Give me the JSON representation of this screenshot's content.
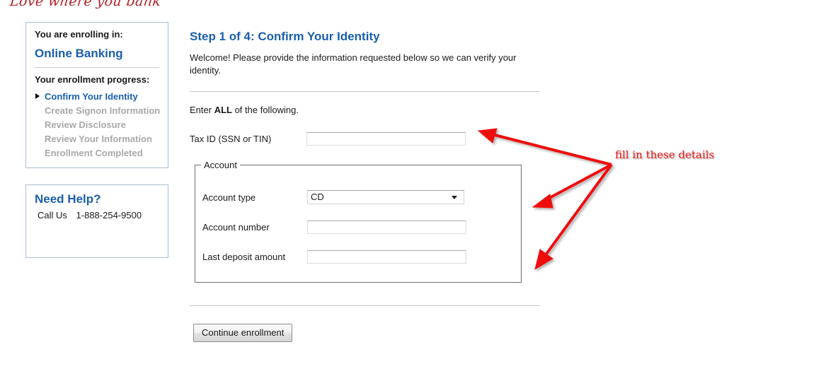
{
  "brand": {
    "tagline": "Love where you bank"
  },
  "sidebar": {
    "enrolling_label": "You are enrolling in:",
    "product": "Online Banking",
    "progress_label": "Your enrollment progress:",
    "steps": [
      {
        "label": "Confirm Your Identity",
        "state": "current"
      },
      {
        "label": "Create Signon Information",
        "state": "pending"
      },
      {
        "label": "Review Disclosure",
        "state": "pending"
      },
      {
        "label": "Review Your Information",
        "state": "pending"
      },
      {
        "label": "Enrollment Completed",
        "state": "pending"
      }
    ],
    "help": {
      "title": "Need Help?",
      "call_label": "Call Us",
      "phone": "1-888-254-9500"
    }
  },
  "main": {
    "title": "Step 1 of 4: Confirm Your Identity",
    "intro": "Welcome! Please provide the information requested below so we can verify your identity.",
    "enter_all_prefix": "Enter ",
    "enter_all_emphasis": "ALL",
    "enter_all_suffix": " of the following.",
    "tax_id": {
      "label": "Tax ID (SSN or TIN)",
      "value": "",
      "placeholder": ""
    },
    "account_group": {
      "legend": "Account",
      "account_type": {
        "label": "Account type",
        "selected": "CD",
        "options": [
          "CD"
        ]
      },
      "account_number": {
        "label": "Account number",
        "value": "",
        "placeholder": ""
      },
      "last_deposit": {
        "label": "Last deposit amount",
        "value": "",
        "placeholder": ""
      }
    },
    "continue_label": "Continue enrollment"
  },
  "annotation": {
    "text": "fill in these details",
    "color": "#ee1111",
    "arrow_count": 3
  },
  "colors": {
    "brand_red": "#b52025",
    "heading_blue": "#1a5fae",
    "pending_gray": "#a8a8a8",
    "panel_border": "#a9bdd4",
    "annotation_red": "#ee1111"
  }
}
